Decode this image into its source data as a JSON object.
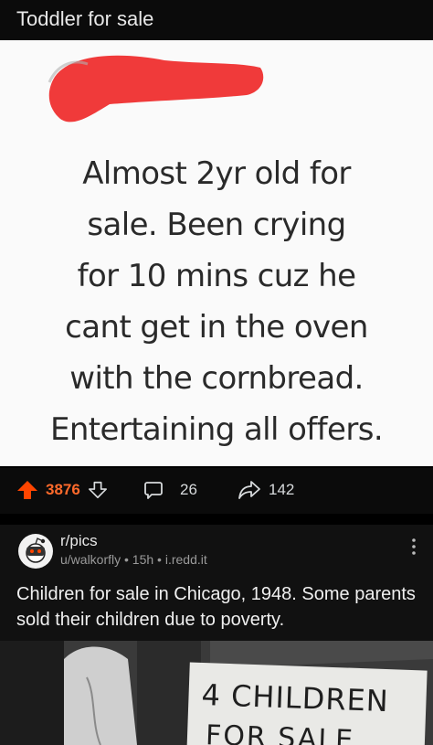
{
  "post1": {
    "title": "Toddler for sale",
    "image_text_lines": [
      "Almost 2yr old for",
      "sale. Been crying",
      "for 10 mins cuz he",
      "cant get in the oven",
      "with the cornbread.",
      "Entertaining all offers."
    ],
    "upvotes": "3876",
    "comments": "26",
    "shares": "142"
  },
  "post2": {
    "subreddit": "r/pics",
    "meta": "u/walkorfly • 15h • i.redd.it",
    "title": "Children for sale in Chicago, 1948. Some parents sold their children due to poverty.",
    "sign_line1": "4 CHILDREN",
    "sign_line2": "FOR SALE"
  },
  "colors": {
    "upvote_active": "#ff4500",
    "redaction": "#f03a3a",
    "background": "#000000"
  },
  "icons": [
    "upvote-icon",
    "downvote-icon",
    "comment-icon",
    "share-icon",
    "more-options-icon"
  ]
}
